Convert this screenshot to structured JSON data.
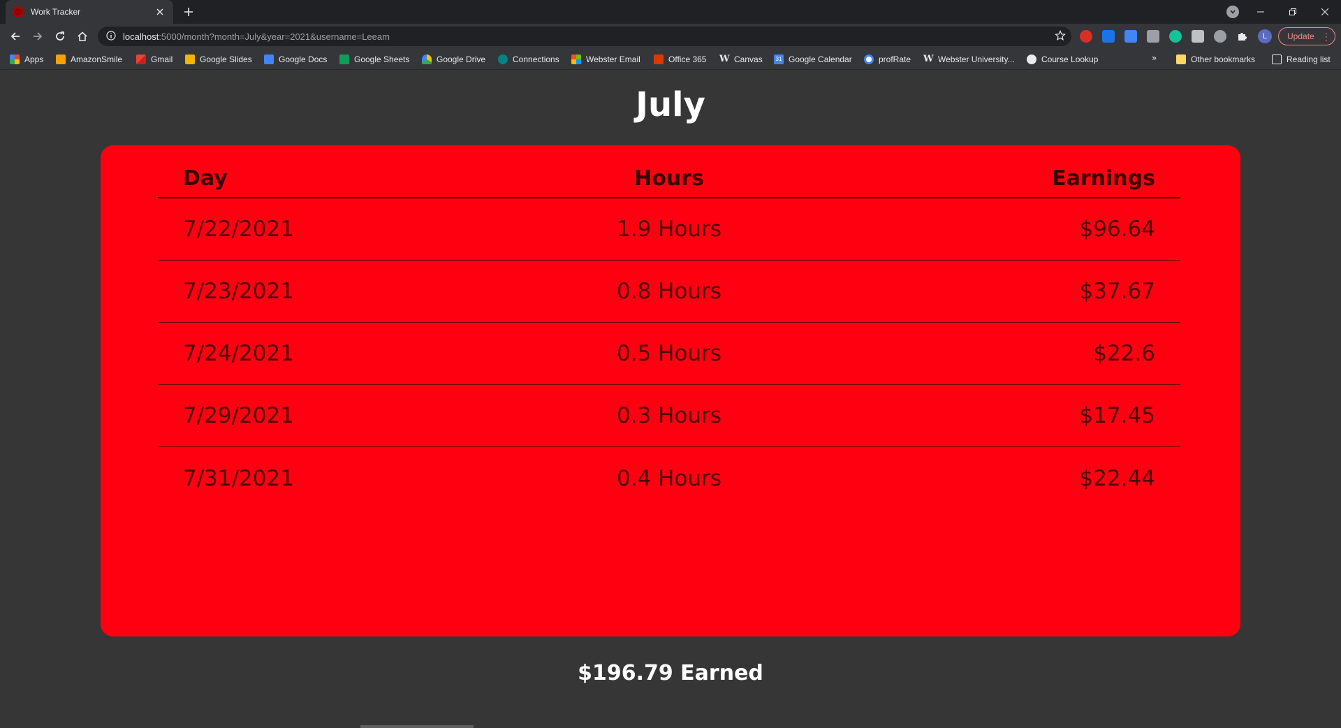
{
  "browser": {
    "tab_title": "Work Tracker",
    "url_host": "localhost",
    "url_rest": ":5000/month?month=July&year=2021&username=Leeam",
    "profile_initial": "L",
    "update_label": "Update",
    "bookmarks": [
      {
        "label": "Apps",
        "icon": "apps-grid-icon",
        "color": "#ea4335"
      },
      {
        "label": "AmazonSmile",
        "icon": "amazon-icon",
        "color": "#f4a300"
      },
      {
        "label": "Gmail",
        "icon": "gmail-icon",
        "color": "#ea4335"
      },
      {
        "label": "Google Slides",
        "icon": "slides-icon",
        "color": "#f4b400"
      },
      {
        "label": "Google Docs",
        "icon": "docs-icon",
        "color": "#4285f4"
      },
      {
        "label": "Google Sheets",
        "icon": "sheets-icon",
        "color": "#0f9d58"
      },
      {
        "label": "Google Drive",
        "icon": "drive-icon",
        "color": "#34a853"
      },
      {
        "label": "Connections",
        "icon": "sharepoint-icon",
        "color": "#038387"
      },
      {
        "label": "Webster Email",
        "icon": "microsoft-icon",
        "color": "#f25022"
      },
      {
        "label": "Office 365",
        "icon": "office-icon",
        "color": "#d83b01"
      },
      {
        "label": "Canvas",
        "icon": "wikipedia-icon",
        "color": "#e8eaed"
      },
      {
        "label": "Google Calendar",
        "icon": "calendar-icon",
        "color": "#4285f4"
      },
      {
        "label": "profRate",
        "icon": "google-icon",
        "color": "#ffffff"
      },
      {
        "label": "Webster University...",
        "icon": "wikipedia-icon",
        "color": "#e8eaed"
      },
      {
        "label": "Course Lookup",
        "icon": "compass-icon",
        "color": "#e8eaed"
      }
    ],
    "more_bookmarks": "»",
    "other_bookmarks": "Other bookmarks",
    "reading_list": "Reading list"
  },
  "page": {
    "title": "July",
    "headers": {
      "day": "Day",
      "hours": "Hours",
      "earnings": "Earnings"
    },
    "rows": [
      {
        "day": "7/22/2021",
        "hours": "1.9 Hours",
        "earnings": "$96.64"
      },
      {
        "day": "7/23/2021",
        "hours": "0.8 Hours",
        "earnings": "$37.67"
      },
      {
        "day": "7/24/2021",
        "hours": "0.5 Hours",
        "earnings": "$22.6"
      },
      {
        "day": "7/29/2021",
        "hours": "0.3 Hours",
        "earnings": "$17.45"
      },
      {
        "day": "7/31/2021",
        "hours": "0.4 Hours",
        "earnings": "$22.44"
      }
    ],
    "total": "$196.79 Earned"
  },
  "colors": {
    "page_bg": "#363636",
    "card_bg": "#ff0010",
    "text_white": "#ffffff"
  }
}
